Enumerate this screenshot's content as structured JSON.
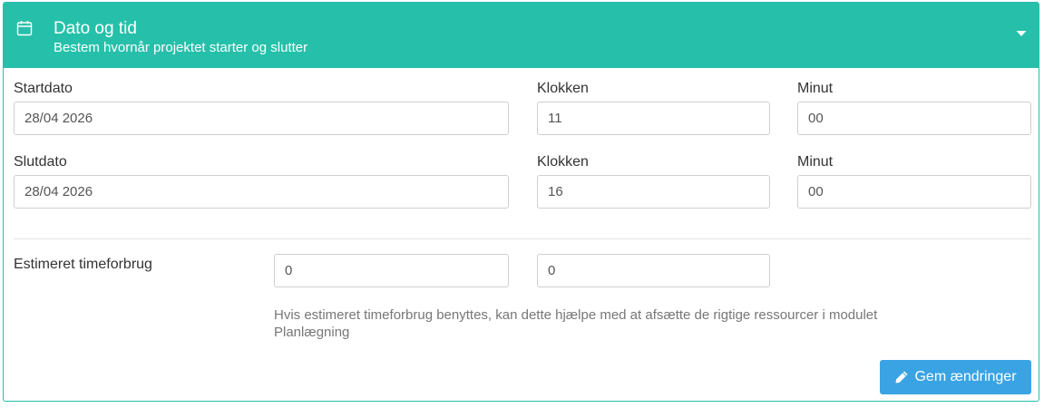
{
  "header": {
    "title": "Dato og tid",
    "subtitle": "Bestem hvornår projektet starter og slutter",
    "icon": "calendar-icon",
    "toggle_icon": "caret-down-icon"
  },
  "start": {
    "date_label": "Startdato",
    "date_value": "28/04 2026",
    "hour_label": "Klokken",
    "hour_value": "11",
    "minute_label": "Minut",
    "minute_value": "00"
  },
  "end": {
    "date_label": "Slutdato",
    "date_value": "28/04 2026",
    "hour_label": "Klokken",
    "hour_value": "16",
    "minute_label": "Minut",
    "minute_value": "00"
  },
  "estimate": {
    "label": "Estimeret timeforbrug",
    "hours_value": "0",
    "minutes_value": "0",
    "help_text": "Hvis estimeret timeforbrug benyttes, kan dette hjælpe med at afsætte de rigtige ressourcer i modulet Planlægning"
  },
  "actions": {
    "save_label": "Gem ændringer",
    "save_icon": "pencil-icon"
  },
  "colors": {
    "header_bg": "#26c0aa",
    "button_bg": "#3aa3e3"
  }
}
